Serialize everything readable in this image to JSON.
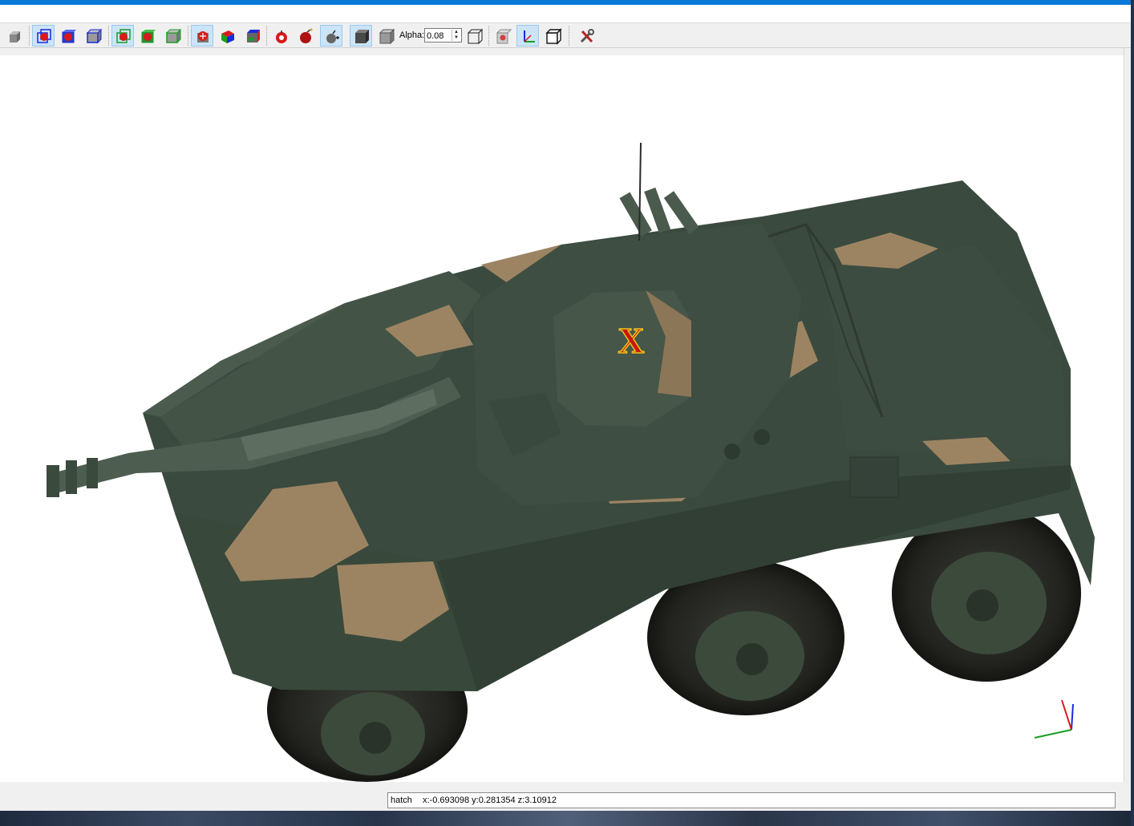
{
  "toolbar": {
    "alpha_label": "Alpha:",
    "alpha_value": "0.08",
    "buttons": [
      {
        "name": "solid-view-icon",
        "on": false
      },
      {
        "name": "wireframe-red-icon",
        "on": true
      },
      {
        "name": "solid-red-box-icon",
        "on": false
      },
      {
        "name": "box-blue-icon",
        "on": false
      },
      {
        "name": "wireframe-green-red-icon",
        "on": true
      },
      {
        "name": "solid-green-red-icon",
        "on": false
      },
      {
        "name": "solid-green-icon",
        "on": false
      },
      {
        "name": "collision-red-icon",
        "on": true
      },
      {
        "name": "color-box-icon",
        "on": false
      },
      {
        "name": "color-cube-icon",
        "on": false
      },
      {
        "name": "bomb-add-icon",
        "on": false
      },
      {
        "name": "bomb-icon",
        "on": false
      },
      {
        "name": "bomb-spark-icon",
        "on": true
      },
      {
        "name": "dark-cube-icon",
        "on": true
      },
      {
        "name": "grey-cube-icon",
        "on": false
      },
      {
        "name": "wire-cube-icon",
        "on": false
      },
      {
        "name": "camera-cube-icon",
        "on": false
      },
      {
        "name": "axes-icon",
        "on": true
      },
      {
        "name": "outline-cube-icon",
        "on": false
      },
      {
        "name": "tools-icon",
        "on": false
      }
    ]
  },
  "viewport": {
    "marker_label": "X",
    "axis_colors": {
      "x": "#18a020",
      "y": "#1a2ae0",
      "z": "#d81a1a"
    }
  },
  "status": {
    "object": "hatch",
    "coords": "x:-0.693098 y:0.281354 z:3.10912"
  }
}
